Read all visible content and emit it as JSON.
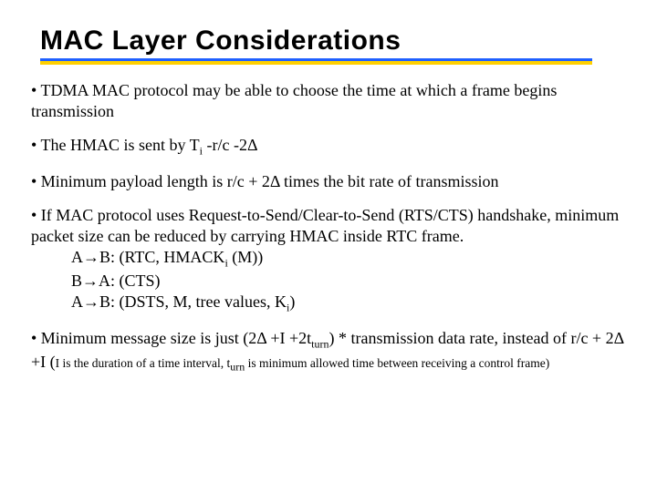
{
  "title": "MAC Layer Considerations",
  "p1": "• TDMA MAC protocol may be able to choose the time at which a frame begins transmission",
  "p2_a": "• The HMAC is sent by T",
  "p2_sub": "i",
  "p2_b": " -r/c -2Δ",
  "p3": "• Minimum payload length is r/c + 2Δ times the bit rate of transmission",
  "p4_l1": "• If MAC protocol uses Request-to-Send/Clear-to-Send (RTS/CTS) handshake, minimum packet size can be reduced by carrying HMAC inside RTC frame.",
  "p4_i1a": "A→B: (RTC, HMACK",
  "p4_i1sub": "i",
  "p4_i1b": " (M))",
  "p4_i2": "B→A: (CTS)",
  "p4_i3a": "A→B: (DSTS, M, tree values, K",
  "p4_i3sub": "i",
  "p4_i3b": ")",
  "p5_a": "• Minimum message size is just (2Δ +I +2t",
  "p5_sub1": "turn",
  "p5_b": ") * transmission data rate, instead of r/c + 2Δ +I (",
  "p5_small_a": "I is the duration of a time interval, t",
  "p5_small_sub": "urn",
  "p5_small_b": " is minimum allowed time between receiving a control frame)"
}
